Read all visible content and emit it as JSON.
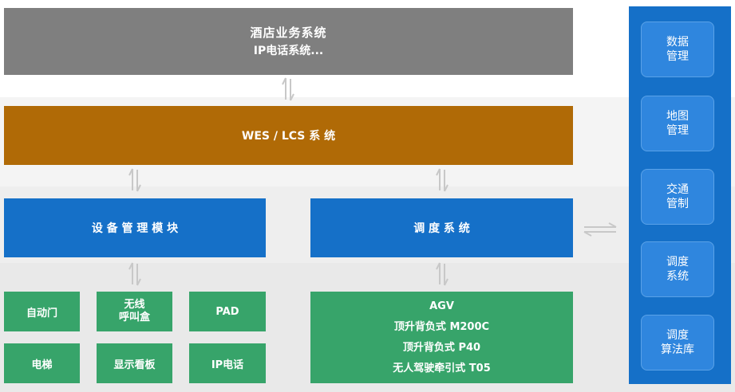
{
  "colors": {
    "gray": "#7f7f7f",
    "brown": "#b06a06",
    "blue": "#1570c8",
    "green": "#37a46a",
    "side_item": "#2f86de",
    "arrow": "#c8c8c8"
  },
  "top_block": {
    "line1": "酒店业务系统",
    "line2": "IP电话系统..."
  },
  "wes_block": {
    "label": "WES / LCS 系 统"
  },
  "device_module": {
    "label": "设 备 管 理 模 块"
  },
  "dispatch": {
    "label": "调 度 系 统"
  },
  "devices": [
    {
      "lines": [
        "自动门"
      ]
    },
    {
      "lines": [
        "无线",
        "呼叫盒"
      ]
    },
    {
      "lines": [
        "PAD"
      ]
    },
    {
      "lines": [
        "电梯"
      ]
    },
    {
      "lines": [
        "显示看板"
      ]
    },
    {
      "lines": [
        "IP电话"
      ]
    }
  ],
  "agv_block": {
    "lines": [
      "AGV",
      "顶升背负式 M200C",
      "顶升背负式 P40",
      "无人驾驶牵引式 T05"
    ]
  },
  "side_panel": {
    "items": [
      {
        "line1": "数据",
        "line2": "管理"
      },
      {
        "line1": "地图",
        "line2": "管理"
      },
      {
        "line1": "交通",
        "line2": "管制"
      },
      {
        "line1": "调度",
        "line2": "系统"
      },
      {
        "line1": "调度",
        "line2": "算法库"
      }
    ]
  }
}
